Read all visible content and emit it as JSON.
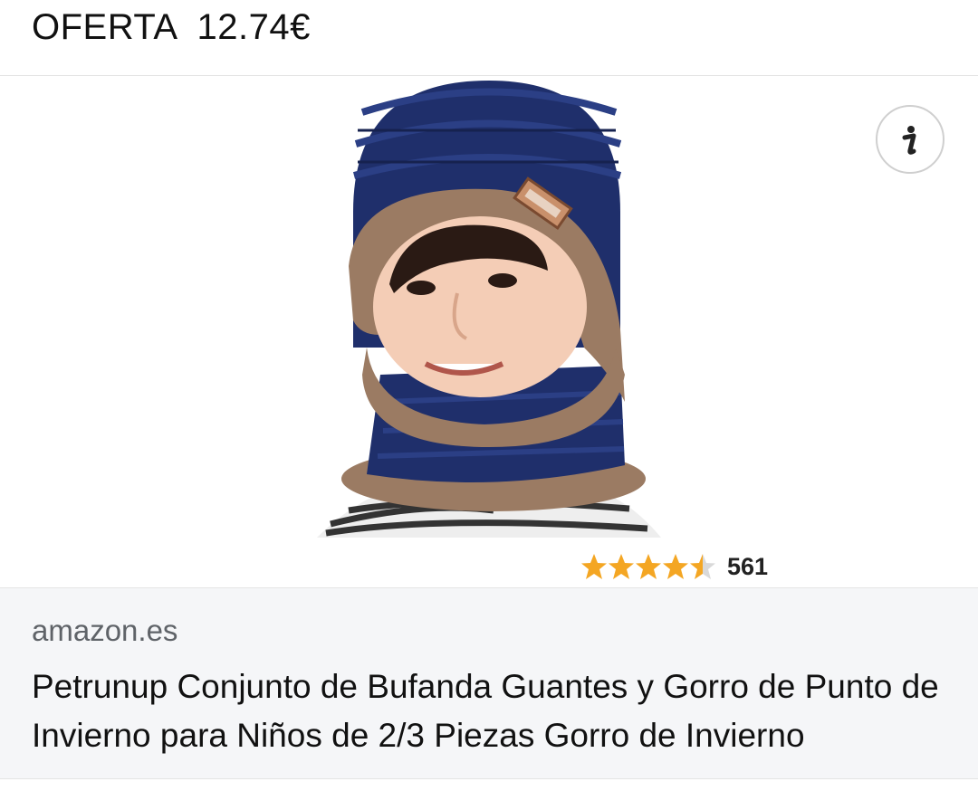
{
  "header": {
    "offer_text": "OFERTA  12.74€"
  },
  "product": {
    "image_description_icon": "hat-scarf-product-image",
    "info_icon": "info-icon",
    "rating": {
      "stars": 4.5,
      "max_stars": 5,
      "count": "561",
      "star_color": "#f4a623"
    }
  },
  "listing": {
    "source": "amazon.es",
    "title": "Petrunup Conjunto de Bufanda Guantes y Gorro de Punto de Invierno para Niños de 2/3 Piezas Gorro de Invierno"
  },
  "colors": {
    "panel_background": "#f5f6f8",
    "hat_navy": "#1f2f6b",
    "fleece_brown": "#9b7b63"
  }
}
